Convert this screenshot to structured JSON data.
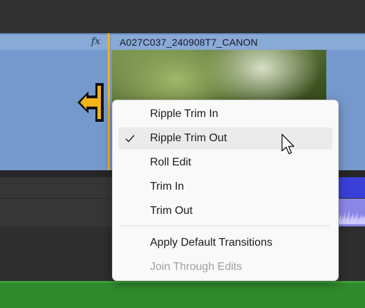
{
  "timeline": {
    "clip_name": "A027C037_240908T7_CANON",
    "fx_label": "fx"
  },
  "context_menu": {
    "items": [
      {
        "label": "Ripple Trim In",
        "checked": false,
        "highlighted": false,
        "enabled": true
      },
      {
        "label": "Ripple Trim Out",
        "checked": true,
        "highlighted": true,
        "enabled": true
      },
      {
        "label": "Roll Edit",
        "checked": false,
        "highlighted": false,
        "enabled": true
      },
      {
        "label": "Trim In",
        "checked": false,
        "highlighted": false,
        "enabled": true
      },
      {
        "label": "Trim Out",
        "checked": false,
        "highlighted": false,
        "enabled": true
      },
      {
        "label": "Apply Default Transitions",
        "checked": false,
        "highlighted": false,
        "enabled": true
      },
      {
        "label": "Join Through Edits",
        "checked": false,
        "highlighted": false,
        "enabled": false
      }
    ]
  },
  "icons": {
    "trim_cursor": "ripple-trim-cursor-icon",
    "check": "checkmark-icon",
    "pointer": "mouse-pointer-icon"
  },
  "colors": {
    "video_clip": "#7599cd",
    "clip_header": "#89a9d6",
    "edit_point": "#f2b418",
    "audio_track": "#3a3fd8",
    "green_track": "#2f8a2c",
    "menu_bg": "#f9f9f9"
  }
}
